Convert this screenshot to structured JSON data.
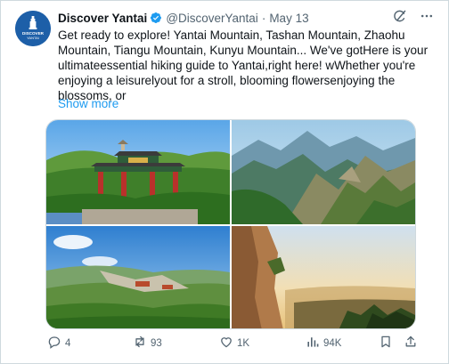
{
  "tweet": {
    "author_name": "Discover Yantai",
    "handle": "@DiscoverYantai",
    "separator": "·",
    "date": "May 13",
    "avatar_text_top": "DISCOVER",
    "avatar_text_bottom": "YANTAI",
    "text": "Get ready to explore! Yantai Mountain, Tashan Mountain, Zhaohu Mountain, Tiangu Mountain, Kunyu Mountain... We've gotHere is your ultimateessential hiking guide to Yantai,right here! wWhether you're enjoying a leisurelyout for a stroll, blooming flowersenjoying the blossoms, or",
    "show_more": "Show more"
  },
  "header_icons": [
    "grok-icon",
    "more-icon"
  ],
  "media": [
    {
      "name": "media-photo-yantai-mountain-gate"
    },
    {
      "name": "media-photo-green-mountain-peaks"
    },
    {
      "name": "media-photo-mountain-temple-complex"
    },
    {
      "name": "media-photo-sunset-cliff"
    }
  ],
  "actions": {
    "replies": "4",
    "reposts": "93",
    "likes": "1K",
    "views": "94K"
  },
  "colors": {
    "accent": "#1d9bf0",
    "text": "#0f1419",
    "muted": "#536471",
    "border": "#cfd9de"
  }
}
